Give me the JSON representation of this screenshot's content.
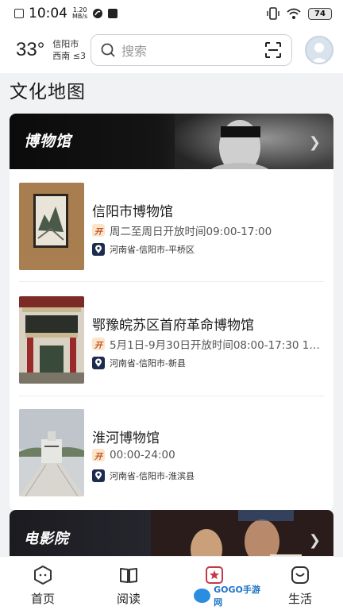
{
  "status_bar": {
    "time": "10:04",
    "net_speed_value": "1.20",
    "net_speed_unit": "MB/s",
    "battery": "74"
  },
  "header": {
    "temperature": "33°",
    "city": "信阳市",
    "wind": "西南 ≤3",
    "search_placeholder": "搜索"
  },
  "page_title": "文化地图",
  "section": {
    "title": "博物馆",
    "items": [
      {
        "name": "信阳市博物馆",
        "badge": "开",
        "hours": "周二至周日开放时间09:00-17:00",
        "address": "河南省-信阳市-平桥区"
      },
      {
        "name": "鄂豫皖苏区首府革命博物馆",
        "badge": "开",
        "hours": "5月1日-9月30日开放时间08:00-17:30 1…",
        "address": "河南省-信阳市-新县"
      },
      {
        "name": "淮河博物馆",
        "badge": "开",
        "hours": "00:00-24:00",
        "address": "河南省-信阳市-淮滨县"
      }
    ]
  },
  "section2": {
    "title": "电影院"
  },
  "bottom_nav": [
    {
      "label": "首页",
      "icon": "home-hexagon-icon"
    },
    {
      "label": "阅读",
      "icon": "book-icon"
    },
    {
      "label": "",
      "icon": "star-map-icon"
    },
    {
      "label": "生活",
      "icon": "bag-smile-icon"
    }
  ],
  "watermark": "GOGO手游网",
  "colors": {
    "accent_orange": "#c2512a",
    "pin_navy": "#1d2b4f",
    "nav_highlight": "#c23a4a"
  }
}
